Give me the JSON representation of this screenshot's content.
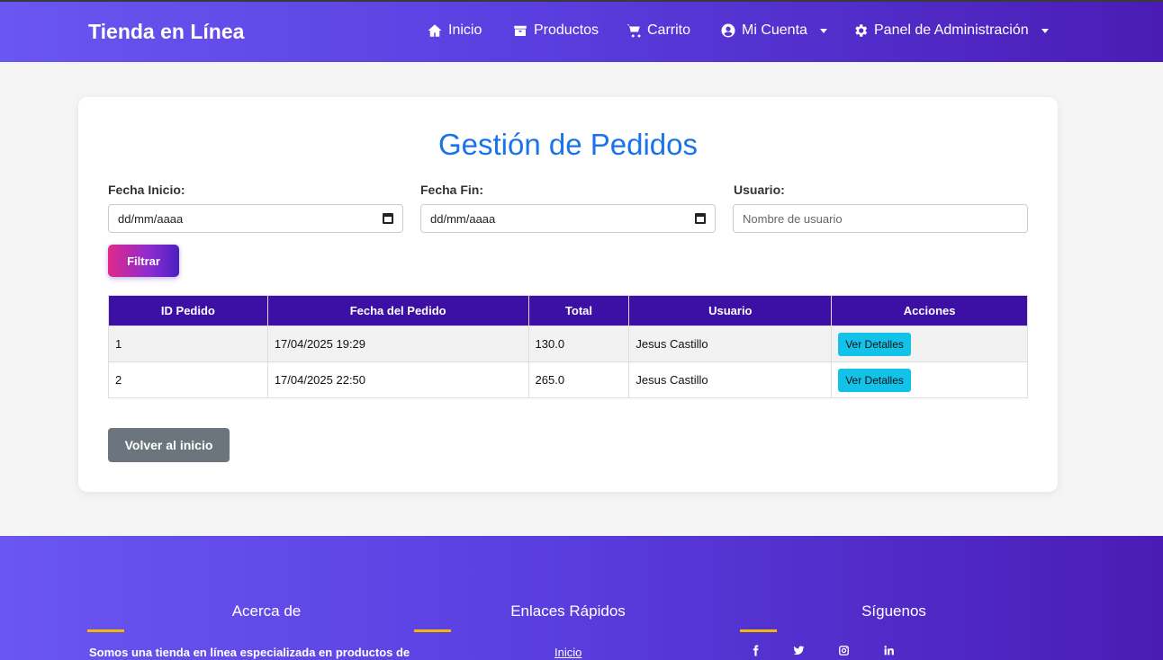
{
  "nav": {
    "brand": "Tienda en Línea",
    "items": [
      {
        "label": "Inicio",
        "icon": "home-icon"
      },
      {
        "label": "Productos",
        "icon": "box-icon"
      },
      {
        "label": "Carrito",
        "icon": "cart-icon"
      },
      {
        "label": "Mi Cuenta",
        "icon": "user-circle-icon",
        "dropdown": true
      },
      {
        "label": "Panel de Administración",
        "icon": "gear-icon",
        "dropdown": true
      }
    ]
  },
  "page": {
    "title": "Gestión de Pedidos"
  },
  "filters": {
    "start_label": "Fecha Inicio:",
    "start_value": "dd/mm/aaaa",
    "end_label": "Fecha Fin:",
    "end_value": "dd/mm/aaaa",
    "user_label": "Usuario:",
    "user_placeholder": "Nombre de usuario",
    "filter_button": "Filtrar"
  },
  "table": {
    "headers": [
      "ID Pedido",
      "Fecha del Pedido",
      "Total",
      "Usuario",
      "Acciones"
    ],
    "rows": [
      {
        "id": "1",
        "date": "17/04/2025 19:29",
        "total": "130.0",
        "user": "Jesus Castillo",
        "action": "Ver Detalles"
      },
      {
        "id": "2",
        "date": "17/04/2025 22:50",
        "total": "265.0",
        "user": "Jesus Castillo",
        "action": "Ver Detalles"
      }
    ]
  },
  "back_button": "Volver al inicio",
  "footer": {
    "about_title": "Acerca de",
    "about_text": "Somos una tienda en línea especializada en productos de",
    "links_title": "Enlaces Rápidos",
    "links": [
      "Inicio"
    ],
    "follow_title": "Síguenos",
    "social": [
      "facebook-icon",
      "twitter-icon",
      "instagram-icon",
      "linkedin-icon"
    ]
  },
  "colors": {
    "header_gradient": [
      "#6a56f0",
      "#4a1cb5"
    ],
    "table_header": "#3c0fa5",
    "title": "#1a73e8",
    "details_button": "#12c2e9",
    "back_button": "#6c757d",
    "footer_accent": "#f5b800"
  }
}
